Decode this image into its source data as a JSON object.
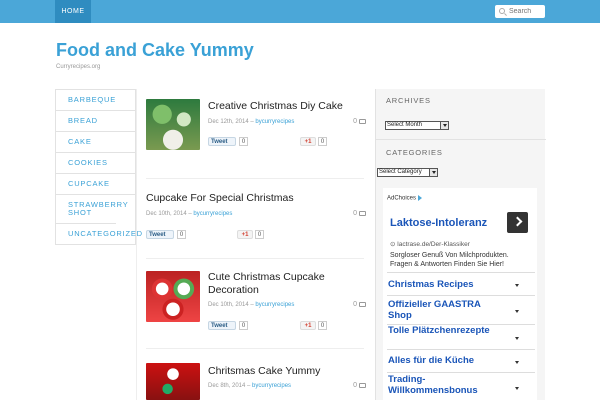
{
  "nav": {
    "home": "HOME"
  },
  "search": {
    "placeholder": "Search"
  },
  "site": {
    "title": "Food and Cake Yummy",
    "tagline": "Curryrecipes.org"
  },
  "categories": [
    "BARBEQUE",
    "BREAD",
    "CAKE",
    "COOKIES",
    "CUPCAKE",
    "STRAWBERRY SHOT",
    "UNCATEGORIZED"
  ],
  "posts": [
    {
      "title": "Creative Christmas Diy Cake",
      "date": "Dec 12th, 2014",
      "author": "bycurryrecipes",
      "comments": "0",
      "tweet": "Tweet",
      "tweet_count": "0",
      "gplus": "+1",
      "gplus_count": "0"
    },
    {
      "title": "Cupcake For Special Christmas",
      "date": "Dec 10th, 2014",
      "author": "bycurryrecipes",
      "comments": "0",
      "tweet": "Tweet",
      "tweet_count": "0",
      "gplus": "+1",
      "gplus_count": "0"
    },
    {
      "title": "Cute Christmas Cupcake Decoration",
      "date": "Dec 10th, 2014",
      "author": "bycurryrecipes",
      "comments": "0",
      "tweet": "Tweet",
      "tweet_count": "0",
      "gplus": "+1",
      "gplus_count": "0"
    },
    {
      "title": "Chritsmas Cake Yummy",
      "date": "Dec 8th, 2014",
      "author": "bycurryrecipes",
      "comments": "0"
    }
  ],
  "sidebar": {
    "archives_title": "ARCHIVES",
    "archives_select": "Select Month",
    "categories_title": "CATEGORIES",
    "categories_select": "Select Category"
  },
  "ad": {
    "adchoices": "AdChoices",
    "headline": "Laktose-Intoleranz",
    "url": "lactrase.de/Der-Klassiker",
    "body": "Sorgloser Genuß Von Milchprodukten. Fragen & Antworten Finden Sie Hier!",
    "links": [
      "Christmas Recipes",
      "Offizieller GAASTRA Shop",
      "Tolle Plätzchenrezepte",
      "Alles für die Küche",
      "Trading-Willkommensbonus"
    ]
  },
  "colors": {
    "accent": "#3aa1d6",
    "topbar": "#4ba7d8",
    "ad_link": "#1a55b8"
  }
}
